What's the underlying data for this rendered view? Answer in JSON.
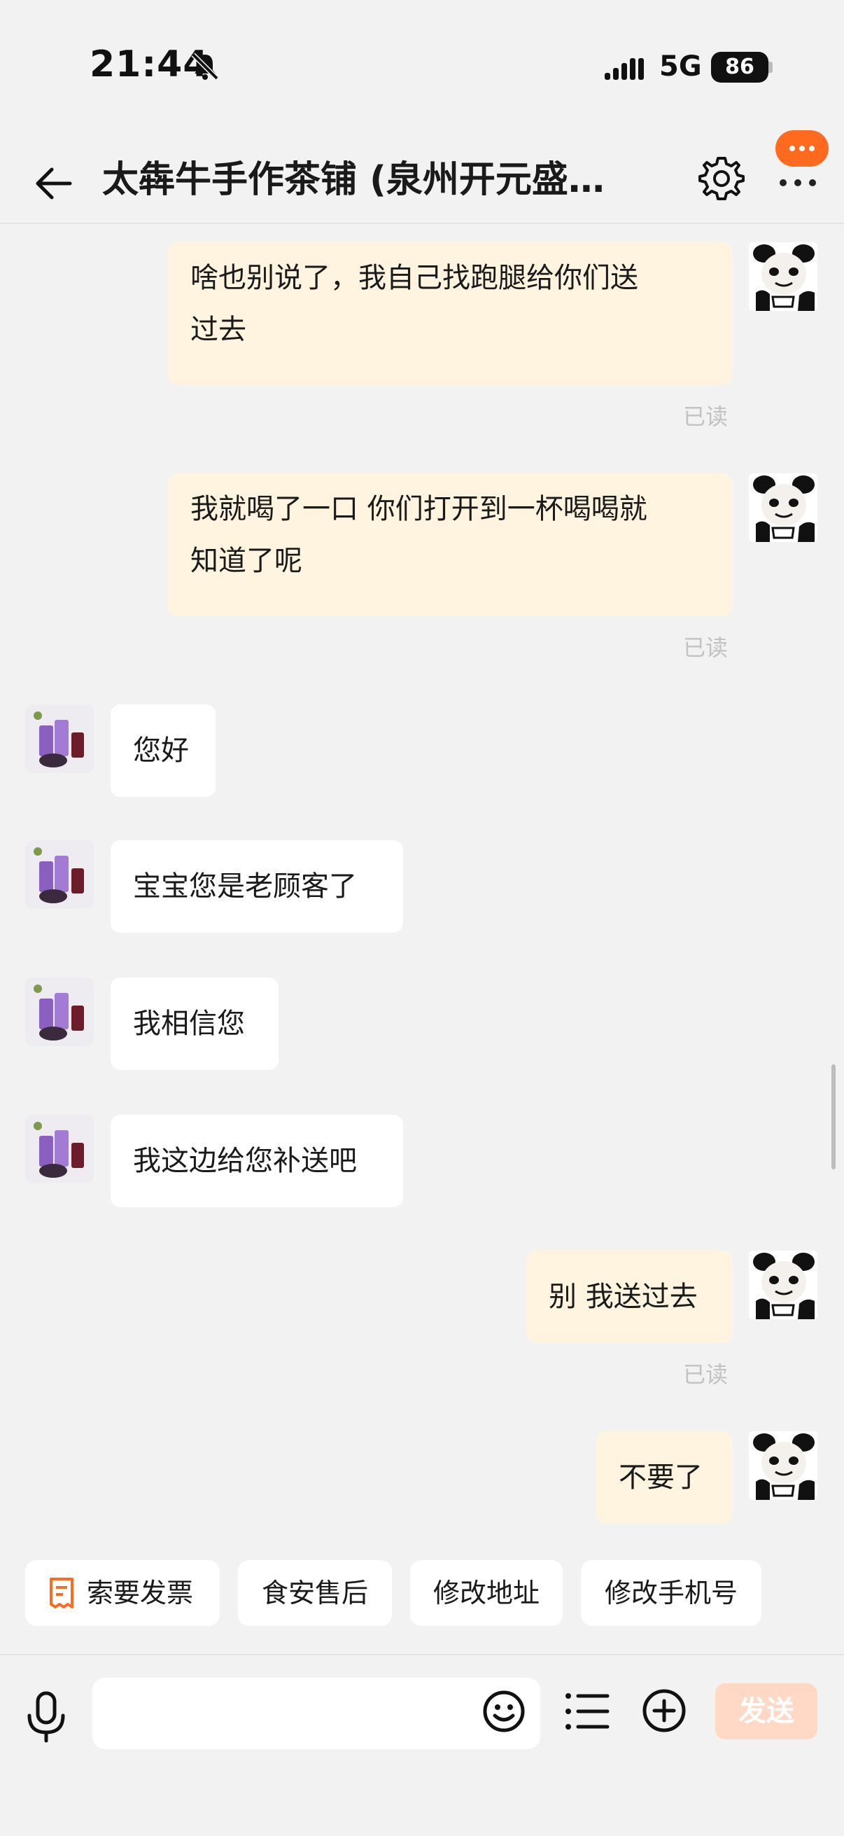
{
  "status_bar": {
    "time": "21:44",
    "network": "5G",
    "battery": "86"
  },
  "header": {
    "title": "太犇牛手作茶铺 (泉州开元盛…"
  },
  "messages": [
    {
      "from": "me",
      "lines": [
        "啥也别说了，我自己找跑腿给你们送",
        "过去"
      ],
      "read": "已读"
    },
    {
      "from": "me",
      "lines": [
        "我就喝了一口 你们打开到一杯喝喝就",
        "知道了呢"
      ],
      "read": "已读"
    },
    {
      "from": "shop",
      "text": "您好"
    },
    {
      "from": "shop",
      "text": "宝宝您是老顾客了"
    },
    {
      "from": "shop",
      "text": "我相信您"
    },
    {
      "from": "shop",
      "text": "我这边给您补送吧"
    },
    {
      "from": "me",
      "text": "别 我送过去",
      "read": "已读"
    },
    {
      "from": "me",
      "text": "不要了"
    }
  ],
  "quick_actions": [
    "索要发票",
    "食安售后",
    "修改地址",
    "修改手机号"
  ],
  "input": {
    "placeholder": "",
    "send_label": "发送"
  },
  "colors": {
    "accent": "#ff6a1f",
    "my_bubble": "#fff4e0",
    "send_disabled": "#ffd9c6"
  },
  "icons": [
    "bell-slash-icon",
    "signal-icon",
    "back-arrow-icon",
    "gear-icon",
    "more-icon",
    "mic-icon",
    "emoji-icon",
    "list-icon",
    "plus-icon",
    "receipt-icon"
  ]
}
